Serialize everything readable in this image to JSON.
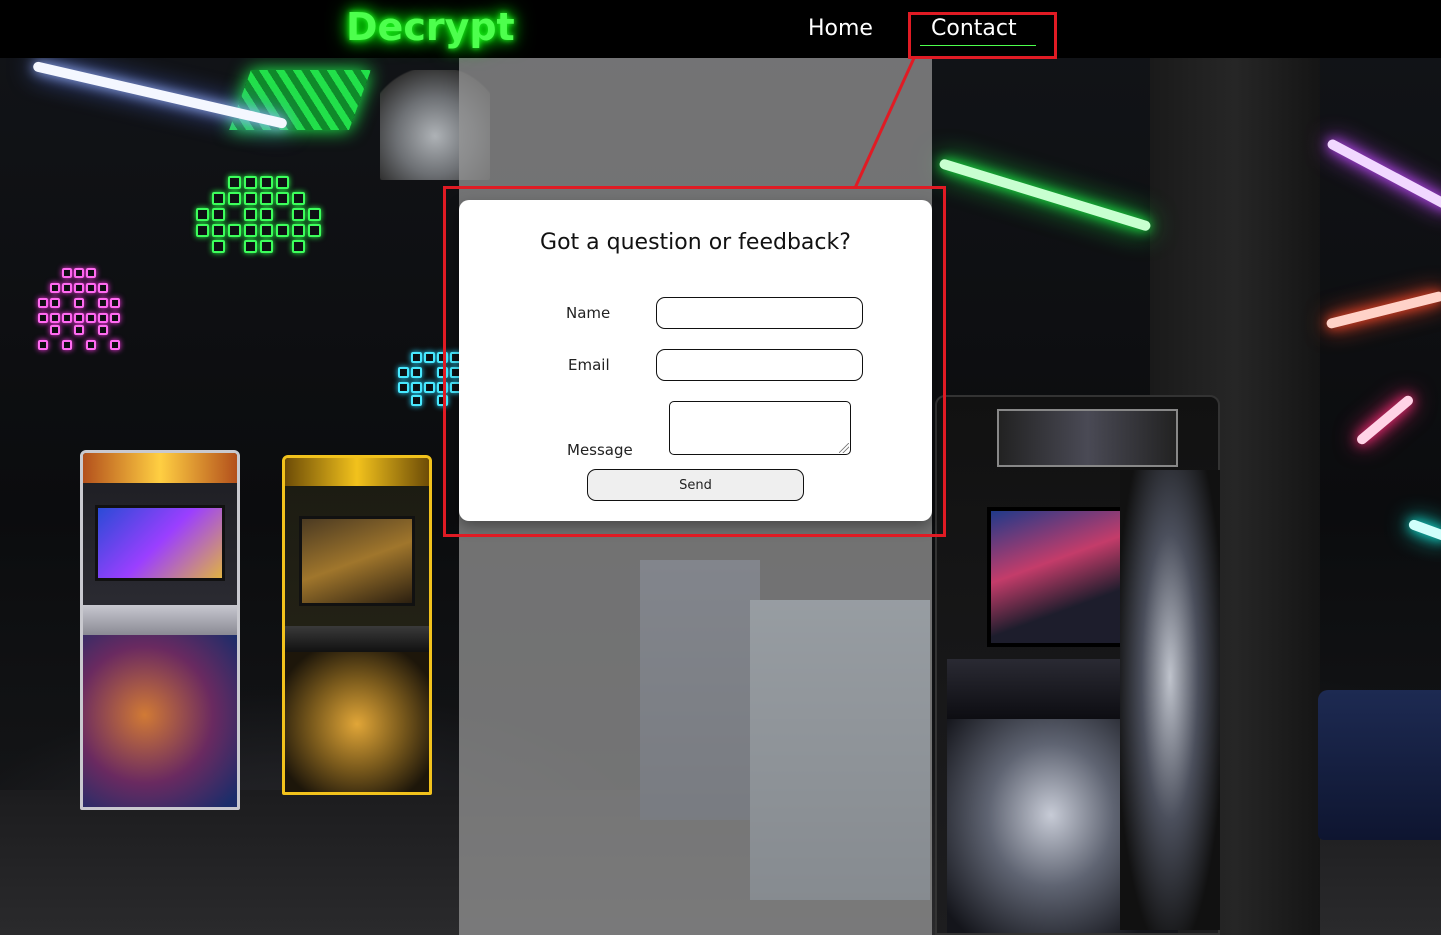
{
  "header": {
    "logo": "Decrypt",
    "nav": {
      "home": "Home",
      "contact": "Contact"
    },
    "active_nav": "Contact"
  },
  "contact_form": {
    "heading": "Got a question or feedback?",
    "name_label": "Name",
    "name_value": "",
    "email_label": "Email",
    "email_value": "",
    "message_label": "Message",
    "message_value": "",
    "send_label": "Send"
  },
  "colors": {
    "logo_glow": "#4dff4d",
    "header_bg": "#000000",
    "highlight": "#e01b24",
    "card_bg": "#ffffff"
  }
}
